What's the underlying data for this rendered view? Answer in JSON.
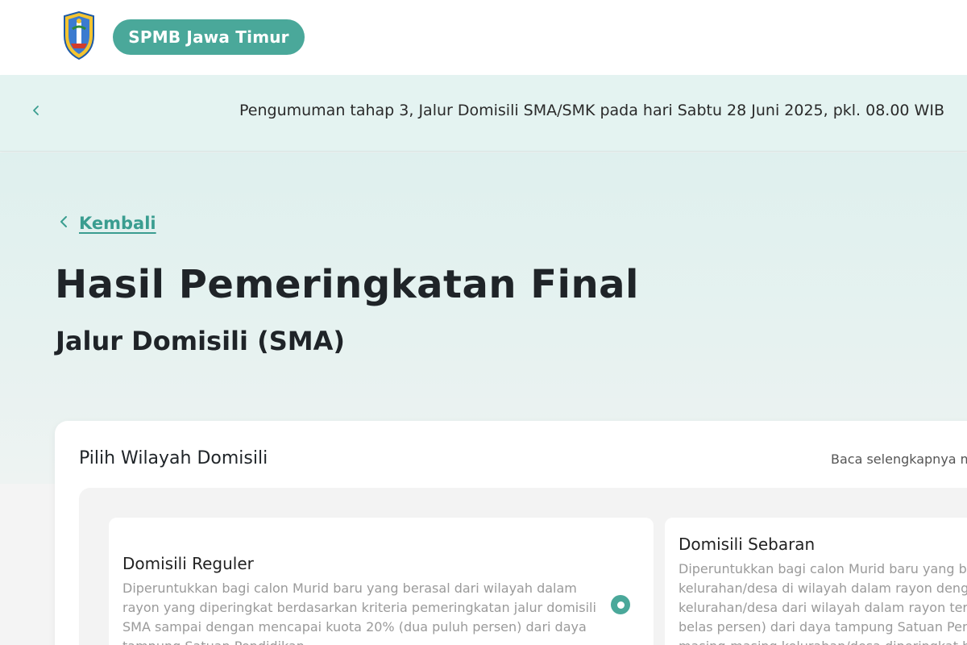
{
  "header": {
    "brand": "SPMB Jawa Timur",
    "logo_icon": "jawa-timur-crest-icon"
  },
  "announcement": {
    "text": "Pengumuman tahap 3, Jalur Domisili SMA/SMK pada hari Sabtu 28 Juni 2025, pkl. 08.00 WIB",
    "prev_icon": "chevron-left-icon"
  },
  "page": {
    "back_label": "Kembali",
    "title": "Hasil Pemeringkatan Final",
    "subtitle": "Jalur Domisili (SMA)"
  },
  "region_selector": {
    "title": "Pilih Wilayah Domisili",
    "read_more": "Baca selengkapnya m",
    "options": [
      {
        "title": "Domisili Reguler",
        "description_lines": [
          "Diperuntukkan bagi calon Murid baru yang berasal dari wilayah dalam",
          "rayon yang diperingkat berdasarkan kriteria pemeringkatan jalur domisili",
          "SMA sampai dengan mencapai kuota 20% (dua puluh persen) dari daya",
          "tampung Satuan Pendidikan"
        ],
        "selected": true
      },
      {
        "title": "Domisili Sebaran",
        "description_lines": [
          "Diperuntukkan bagi calon Murid baru yang ber",
          "kelurahan/desa di wilayah dalam rayon denga",
          "kelurahan/desa dari wilayah dalam rayon terse",
          "belas persen) dari daya tampung Satuan Pend",
          "masing-masing kelurahan/desa diperingkat berdasa"
        ],
        "selected": false
      }
    ]
  },
  "colors": {
    "accent": "#4aa89a",
    "link": "#3a9d90",
    "announce_bg": "#e4f3f1",
    "hero_bg": "#dff0ee"
  }
}
